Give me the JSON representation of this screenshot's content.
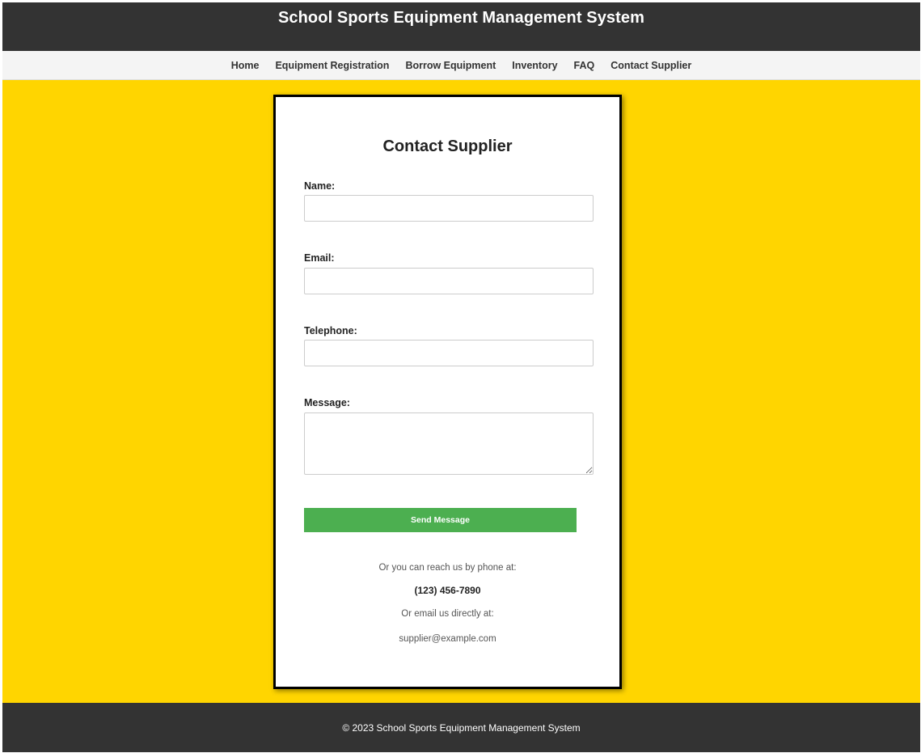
{
  "header": {
    "title": "School Sports Equipment Management System"
  },
  "nav": {
    "items": [
      {
        "label": "Home"
      },
      {
        "label": "Equipment Registration"
      },
      {
        "label": "Borrow Equipment"
      },
      {
        "label": "Inventory"
      },
      {
        "label": "FAQ"
      },
      {
        "label": "Contact Supplier"
      }
    ]
  },
  "form": {
    "title": "Contact Supplier",
    "name_label": "Name:",
    "name_value": "",
    "email_label": "Email:",
    "email_value": "",
    "telephone_label": "Telephone:",
    "telephone_value": "",
    "message_label": "Message:",
    "message_value": "",
    "send_label": "Send Message"
  },
  "contact": {
    "phone_intro": "Or you can reach us by phone at:",
    "phone": "(123) 456-7890",
    "email_intro": "Or email us directly at:",
    "email": "supplier@example.com"
  },
  "footer": {
    "text": "© 2023 School Sports Equipment Management System"
  },
  "colors": {
    "header_bg": "#333333",
    "nav_bg": "#f4f4f4",
    "main_bg": "#ffd500",
    "button_bg": "#4caf50",
    "footer_bg": "#333333"
  }
}
